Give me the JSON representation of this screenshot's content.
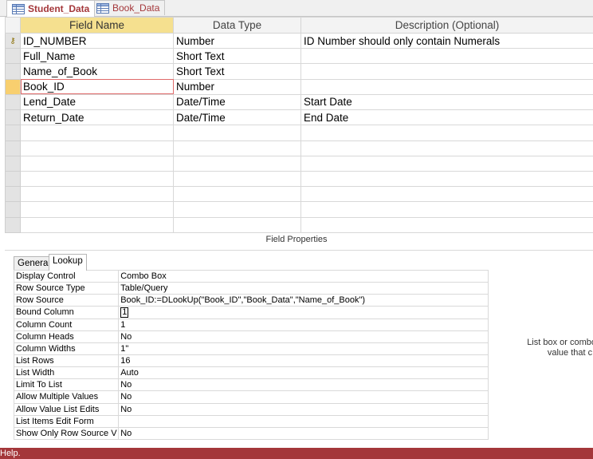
{
  "tabs": [
    {
      "label": "Student_Data",
      "active": true
    },
    {
      "label": "Book_Data",
      "active": false
    }
  ],
  "grid": {
    "headers": {
      "field_name": "Field Name",
      "data_type": "Data Type",
      "description": "Description (Optional)"
    },
    "rows": [
      {
        "name": "ID_NUMBER",
        "type": "Number",
        "description": "ID Number should only contain Numerals",
        "primary_key": true
      },
      {
        "name": "Full_Name",
        "type": "Short Text",
        "description": ""
      },
      {
        "name": "Name_of_Book",
        "type": "Short Text",
        "description": ""
      },
      {
        "name": "Book_ID",
        "type": "Number",
        "description": "",
        "current": true
      },
      {
        "name": "Lend_Date",
        "type": "Date/Time",
        "description": "Start Date"
      },
      {
        "name": "Return_Date",
        "type": "Date/Time",
        "description": "End Date"
      },
      {
        "name": "",
        "type": "",
        "description": ""
      },
      {
        "name": "",
        "type": "",
        "description": ""
      },
      {
        "name": "",
        "type": "",
        "description": ""
      },
      {
        "name": "",
        "type": "",
        "description": ""
      },
      {
        "name": "",
        "type": "",
        "description": ""
      },
      {
        "name": "",
        "type": "",
        "description": ""
      },
      {
        "name": "",
        "type": "",
        "description": ""
      }
    ]
  },
  "field_properties": {
    "title": "Field Properties",
    "tabs": [
      {
        "label": "General",
        "active": false
      },
      {
        "label": "Lookup",
        "active": true
      }
    ],
    "rows": [
      {
        "name": "Display Control",
        "value": "Combo Box"
      },
      {
        "name": "Row Source Type",
        "value": "Table/Query"
      },
      {
        "name": "Row Source",
        "value": " Book_ID:=DLookUp(\"Book_ID\",\"Book_Data\",\"Name_of_Book\")"
      },
      {
        "name": "Bound Column",
        "value": "1",
        "editing": true
      },
      {
        "name": "Column Count",
        "value": "1"
      },
      {
        "name": "Column Heads",
        "value": "No"
      },
      {
        "name": "Column Widths",
        "value": "1\""
      },
      {
        "name": "List Rows",
        "value": "16"
      },
      {
        "name": "List Width",
        "value": "Auto"
      },
      {
        "name": "Limit To List",
        "value": "No"
      },
      {
        "name": "Allow Multiple Values",
        "value": "No"
      },
      {
        "name": "Allow Value List Edits",
        "value": "No"
      },
      {
        "name": "List Items Edit Form",
        "value": ""
      },
      {
        "name": "Show Only Row Source V",
        "value": "No"
      }
    ],
    "help_line1": "List box or combo box",
    "help_line2": "value that c"
  },
  "status_bar": {
    "text": "Help."
  },
  "colors": {
    "accent": "#a4373a",
    "header_highlight": "#f5e08f",
    "row_selector_current": "#f8cf6f"
  }
}
